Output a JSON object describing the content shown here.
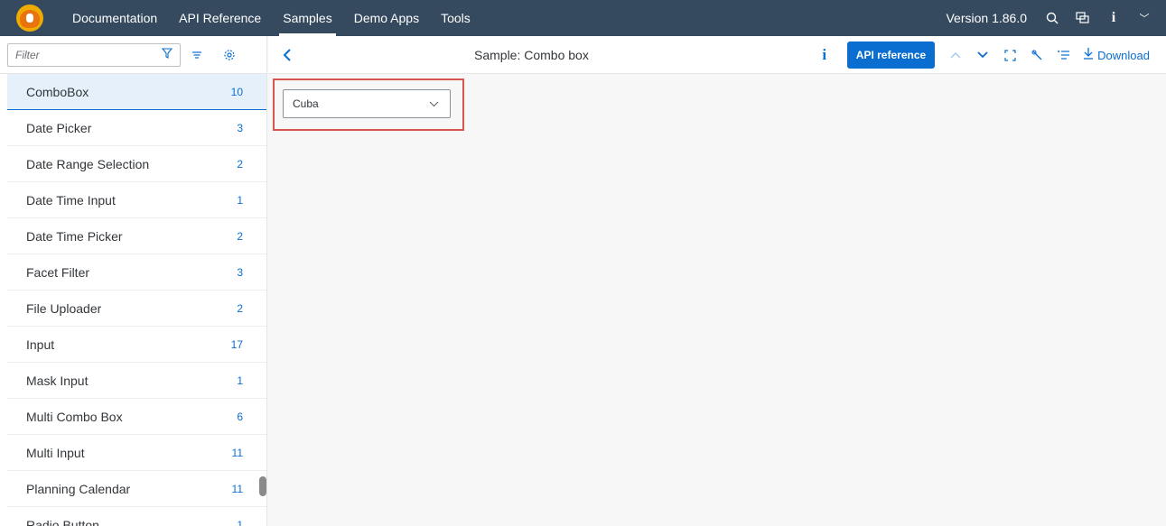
{
  "shell": {
    "nav": [
      "Documentation",
      "API Reference",
      "Samples",
      "Demo Apps",
      "Tools"
    ],
    "active_index": 2,
    "version": "Version 1.86.0",
    "icons": [
      "search-icon",
      "feedback-icon",
      "info-icon"
    ]
  },
  "sidebar": {
    "filter_placeholder": "Filter",
    "items": [
      {
        "label": "ComboBox",
        "count": "10"
      },
      {
        "label": "Date Picker",
        "count": "3"
      },
      {
        "label": "Date Range Selection",
        "count": "2"
      },
      {
        "label": "Date Time Input",
        "count": "1"
      },
      {
        "label": "Date Time Picker",
        "count": "2"
      },
      {
        "label": "Facet Filter",
        "count": "3"
      },
      {
        "label": "File Uploader",
        "count": "2"
      },
      {
        "label": "Input",
        "count": "17"
      },
      {
        "label": "Mask Input",
        "count": "1"
      },
      {
        "label": "Multi Combo Box",
        "count": "6"
      },
      {
        "label": "Multi Input",
        "count": "11"
      },
      {
        "label": "Planning Calendar",
        "count": "11"
      },
      {
        "label": "Radio Button",
        "count": "1"
      }
    ],
    "selected_index": 0
  },
  "sample": {
    "title": "Sample: Combo box",
    "api_reference_label": "API reference",
    "download_label": "Download"
  },
  "content": {
    "combo_value": "Cuba"
  }
}
